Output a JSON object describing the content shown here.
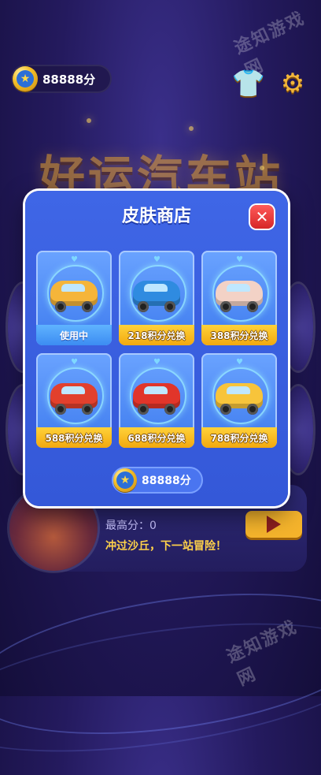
{
  "header": {
    "coins": "88888分"
  },
  "background": {
    "title": "好运汽车站",
    "best_score": "最高分：0",
    "description": "冲过沙丘，下一站冒险！"
  },
  "modal": {
    "title": "皮肤商店",
    "close_icon": "close-icon",
    "items": [
      {
        "label": "使用中",
        "color": "#f5b53a"
      },
      {
        "label": "218积分兑换",
        "color": "#2f8be0"
      },
      {
        "label": "388积分兑换",
        "color": "#f3d2c6"
      },
      {
        "label": "588积分兑换",
        "color": "#e2402d"
      },
      {
        "label": "688积分兑换",
        "color": "#e1352a"
      },
      {
        "label": "788积分兑换",
        "color": "#f7c43b"
      }
    ],
    "coins": "88888分"
  },
  "icons": {
    "shirt": "shirt-swap-icon",
    "settings": "gear-icon",
    "play": "play-icon",
    "coin": "star-coin-icon"
  },
  "watermarks": [
    "途知游戏网",
    "途知游戏网"
  ]
}
